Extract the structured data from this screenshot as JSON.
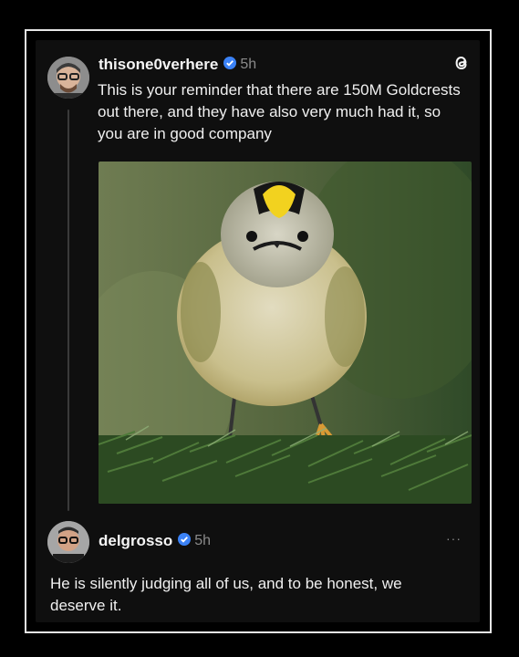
{
  "post": {
    "username": "thisone0verhere",
    "time": "5h",
    "text": "This is your reminder that there are 150M Goldcrests out there, and they have also very much had it, so you are in good company",
    "image_subject": "goldcrest-photo"
  },
  "reply": {
    "username": "delgrosso",
    "time": "5h",
    "text": "He is silently judging all of us, and to be honest, we deserve it.",
    "more_label": "···"
  },
  "icons": {
    "app": "threads-icon",
    "verified": "verified-badge-icon",
    "verified_color": "#3b82f6"
  }
}
